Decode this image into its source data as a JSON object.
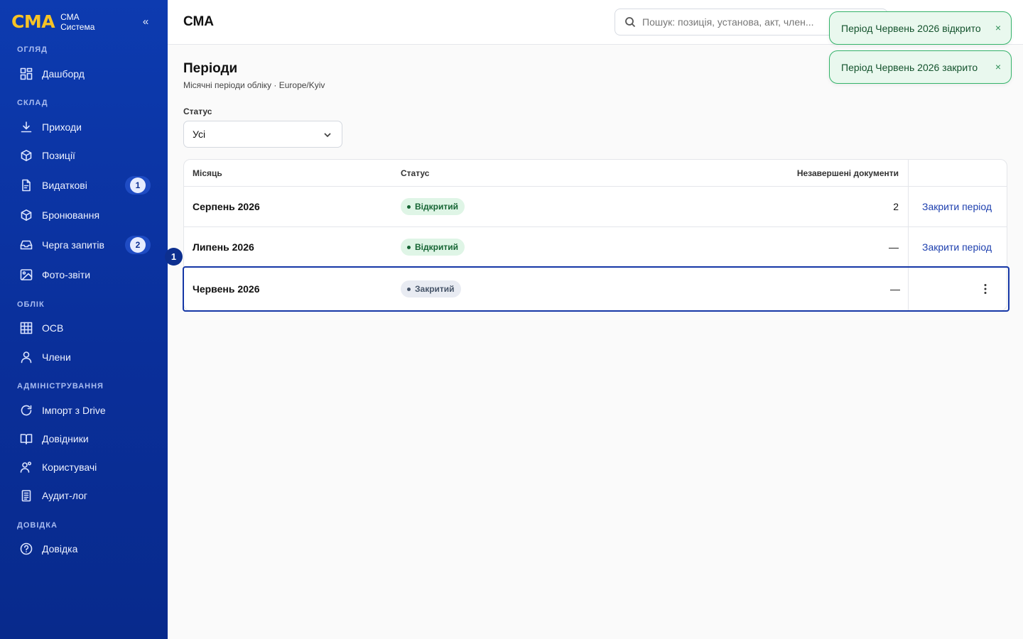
{
  "brand": {
    "logo": "СМА",
    "line1": "СМА",
    "line2": "Система",
    "collapse": "«"
  },
  "sidebar": {
    "sections": [
      {
        "label": "ОГЛЯД"
      },
      {
        "label": "СКЛАД"
      },
      {
        "label": "ОБЛІК"
      },
      {
        "label": "АДМІНІСТРУВАННЯ"
      },
      {
        "label": "ДОВІДКА"
      }
    ],
    "items": [
      {
        "label": "Дашборд",
        "icon": "dashboard-icon"
      },
      {
        "label": "Приходи",
        "icon": "download-icon"
      },
      {
        "label": "Позиції",
        "icon": "box-icon"
      },
      {
        "label": "Видаткові",
        "icon": "document-icon",
        "badge": "1"
      },
      {
        "label": "Бронювання",
        "icon": "box-icon"
      },
      {
        "label": "Черга запитів",
        "icon": "inbox-icon",
        "badge": "2"
      },
      {
        "label": "Фото-звіти",
        "icon": "image-icon"
      },
      {
        "label": "ОСВ",
        "icon": "table-icon"
      },
      {
        "label": "Члени",
        "icon": "user-icon"
      },
      {
        "label": "Імпорт з Drive",
        "icon": "refresh-icon"
      },
      {
        "label": "Довідники",
        "icon": "book-icon"
      },
      {
        "label": "Користувачі",
        "icon": "users-icon"
      },
      {
        "label": "Аудит-лог",
        "icon": "clipboard-icon"
      },
      {
        "label": "Довідка",
        "icon": "help-icon"
      }
    ]
  },
  "header": {
    "title": "СМА",
    "search_placeholder": "Пошук: позиція, установа, акт, член..."
  },
  "toasts": [
    {
      "text": "Період Червень 2026 відкрито",
      "close": "×"
    },
    {
      "text": "Період Червень 2026 закрито",
      "close": "×"
    }
  ],
  "page": {
    "title": "Періоди",
    "subtitle": "Місячні періоди обліку · Europe/Kyiv",
    "filter": {
      "label": "Статус",
      "value": "Усі"
    }
  },
  "table": {
    "columns": {
      "month": "Місяць",
      "status": "Статус",
      "pending": "Незавершені документи"
    },
    "rows": [
      {
        "month": "Серпень 2026",
        "status": "Відкритий",
        "pending": "2",
        "action": "Закрити період"
      },
      {
        "month": "Липень 2026",
        "status": "Відкритий",
        "pending": "—",
        "action": "Закрити період"
      },
      {
        "month": "Червень 2026",
        "status": "Закритий",
        "pending": "—",
        "action": ""
      }
    ]
  },
  "step_marker": "1",
  "colors": {
    "sidebar": "#0a2f9a",
    "accent": "#f7c325",
    "link": "#1d3fae",
    "success": "#34b36a"
  }
}
